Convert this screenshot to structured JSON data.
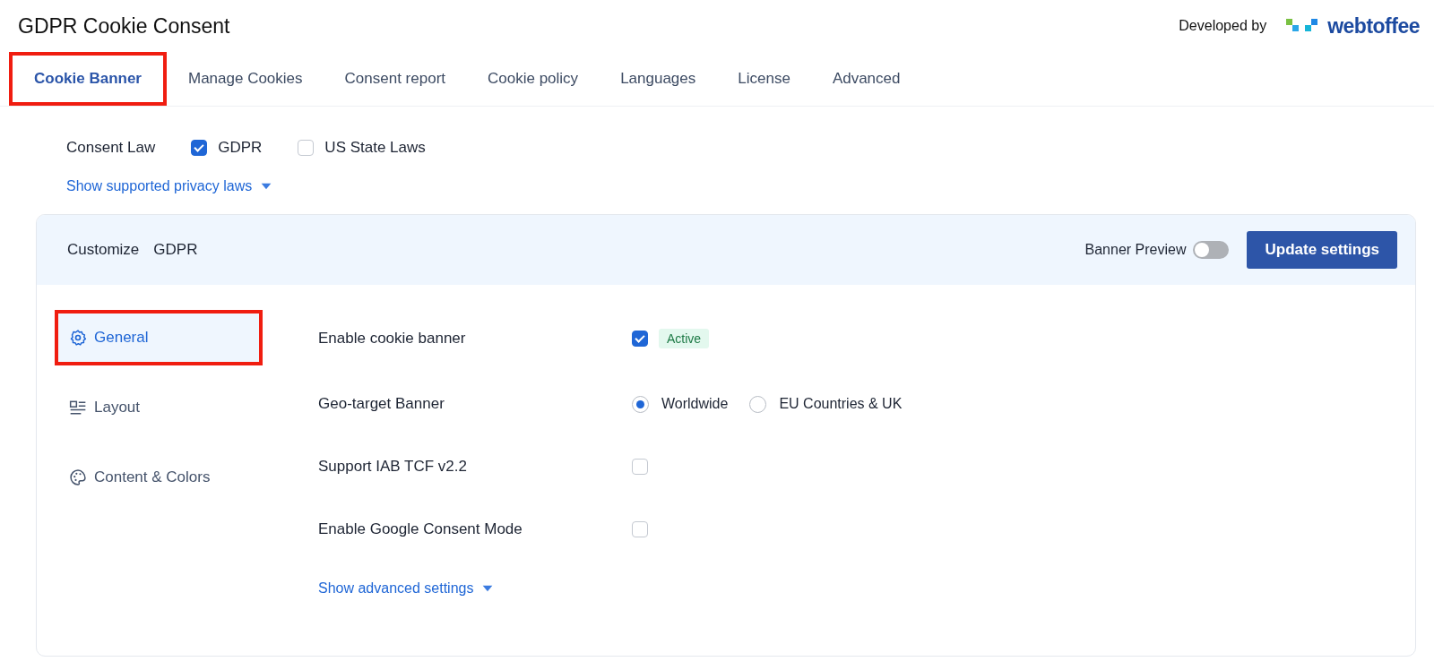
{
  "header": {
    "title": "GDPR Cookie Consent",
    "developed_by": "Developed by",
    "brand": "webtoffee"
  },
  "tabs": [
    {
      "label": "Cookie Banner",
      "selected": true,
      "highlighted": true
    },
    {
      "label": "Manage Cookies",
      "selected": false,
      "highlighted": false
    },
    {
      "label": "Consent report",
      "selected": false,
      "highlighted": false
    },
    {
      "label": "Cookie policy",
      "selected": false,
      "highlighted": false
    },
    {
      "label": "Languages",
      "selected": false,
      "highlighted": false
    },
    {
      "label": "License",
      "selected": false,
      "highlighted": false
    },
    {
      "label": "Advanced",
      "selected": false,
      "highlighted": false
    }
  ],
  "consent_law": {
    "label": "Consent Law",
    "options": [
      {
        "label": "GDPR",
        "checked": true
      },
      {
        "label": "US State Laws",
        "checked": false
      }
    ],
    "link": "Show supported privacy laws"
  },
  "panel": {
    "customize_label": "Customize",
    "customize_value": "GDPR",
    "preview_label": "Banner Preview",
    "preview_on": false,
    "update_button": "Update settings",
    "sidebar": [
      {
        "label": "General",
        "selected": true,
        "highlighted": true
      },
      {
        "label": "Layout",
        "selected": false,
        "highlighted": false
      },
      {
        "label": "Content & Colors",
        "selected": false,
        "highlighted": false
      }
    ],
    "settings": [
      {
        "kind": "checkbox",
        "label": "Enable cookie banner",
        "checked": true,
        "badge": "Active"
      },
      {
        "kind": "radio",
        "label": "Geo-target Banner",
        "options": [
          {
            "label": "Worldwide",
            "selected": true
          },
          {
            "label": "EU Countries & UK",
            "selected": false
          }
        ]
      },
      {
        "kind": "checkbox",
        "label": "Support IAB TCF v2.2",
        "checked": false
      },
      {
        "kind": "checkbox",
        "label": "Enable Google Consent Mode",
        "checked": false
      }
    ],
    "advanced_link": "Show advanced settings"
  }
}
